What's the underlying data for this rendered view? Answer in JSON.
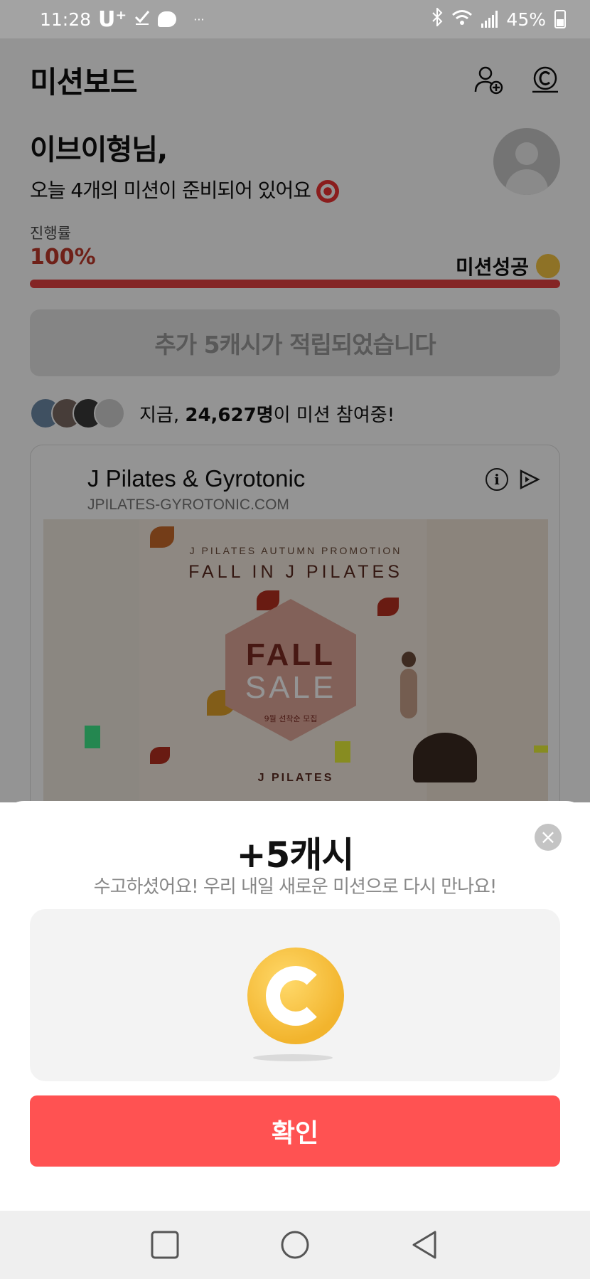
{
  "status_bar": {
    "time": "11:28",
    "carrier": "U⁺",
    "overflow": "···",
    "battery": "45%",
    "icons": [
      "check-icon",
      "chat-icon",
      "bluetooth-icon",
      "wifi-icon",
      "signal-icon",
      "battery-icon"
    ]
  },
  "header": {
    "title": "미션보드",
    "icons": [
      "add-friend-icon",
      "cash-icon"
    ]
  },
  "greeting": {
    "name": "이브이형님,",
    "subtitle": "오늘 4개의 미션이 준비되어 있어요"
  },
  "progress": {
    "label": "진행률",
    "percent_text": "100%",
    "value": 1.0,
    "status": "미션성공"
  },
  "notice": "추가 5캐시가 적립되었습니다",
  "participants": {
    "prefix": "지금, ",
    "count": "24,627명",
    "suffix": "이 미션 참여중!"
  },
  "ad": {
    "title": "J Pilates & Gyrotonic",
    "url": "JPILATES-GYROTONIC.COM",
    "banner": {
      "kicker": "J PILATES AUTUMN PROMOTION",
      "headline": "FALL IN J PILATES",
      "sale_line1": "FALL",
      "sale_line2": "SALE",
      "sale_note": "9월 선착순 모집",
      "brand": "J PILATES"
    }
  },
  "modal": {
    "reward": "+5캐시",
    "message": "수고하셨어요! 우리 내일 새로운 미션으로 다시 만나요!",
    "confirm_label": "확인",
    "close_label": "×"
  },
  "colors": {
    "accent": "#ff5252",
    "progress": "#e34040",
    "coin": "#f2b42d"
  }
}
